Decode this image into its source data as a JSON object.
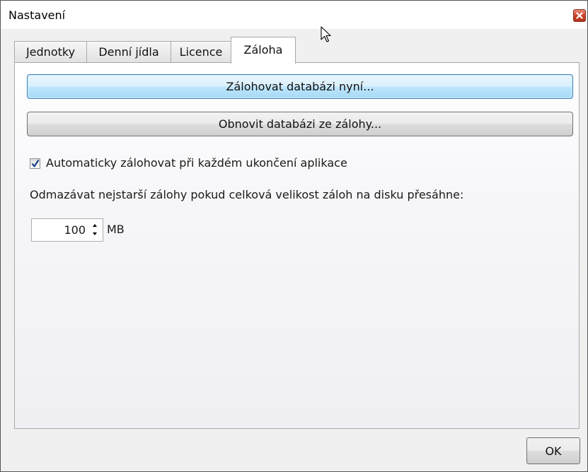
{
  "window": {
    "title": "Nastavení"
  },
  "tabs": [
    {
      "label": "Jednotky",
      "active": false
    },
    {
      "label": "Denní jídla",
      "active": false
    },
    {
      "label": "Licence",
      "active": false
    },
    {
      "label": "Záloha",
      "active": true
    }
  ],
  "backup": {
    "backup_now_label": "Zálohovat databázi nyní...",
    "restore_label": "Obnovit databázi ze zálohy...",
    "auto_backup_label": "Automaticky zálohovat při každém ukončení aplikace",
    "auto_backup_checked": true,
    "cleanup_text": "Odmazávat nejstarší zálohy pokud celková velikost záloh na disku přesáhne:",
    "size_limit_value": "100",
    "size_unit": "MB"
  },
  "footer": {
    "ok_label": "OK"
  },
  "icons": {
    "close": "close-icon",
    "cursor": "mouse-cursor-icon",
    "check": "checkmark-icon",
    "spin_up": "chevron-up-icon",
    "spin_down": "chevron-down-icon"
  },
  "colors": {
    "close_button": "#c8432a",
    "focused_button": "#bee6fd",
    "checkmark": "#1c3f8c"
  }
}
